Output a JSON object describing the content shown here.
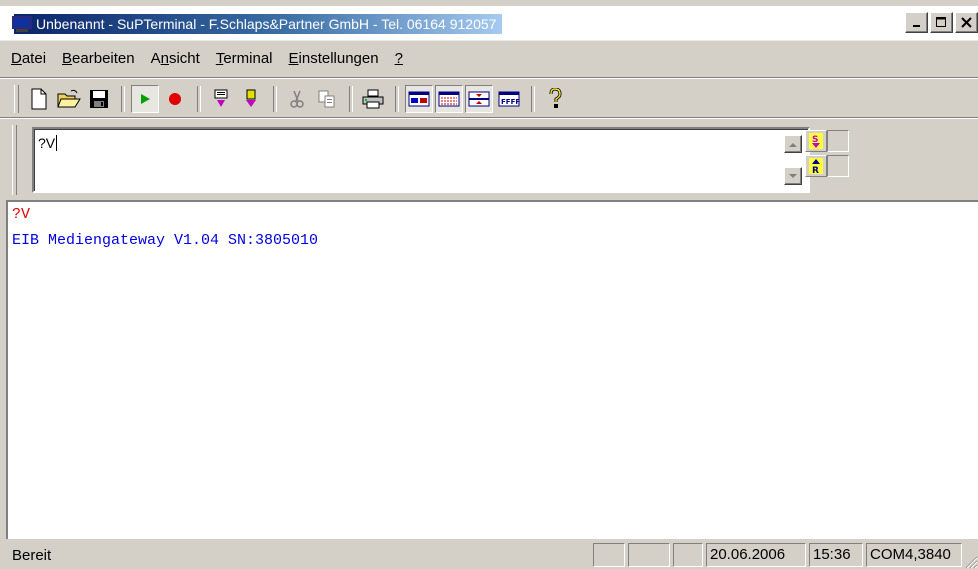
{
  "window": {
    "title": "Unbenannt - SuPTerminal - F.Schlaps&Partner GmbH - Tel. 06164 912057"
  },
  "menu": {
    "items": [
      {
        "label": "Datei",
        "accel": "D",
        "rest": "atei"
      },
      {
        "label": "Bearbeiten",
        "accel": "B",
        "rest": "earbeiten"
      },
      {
        "label": "Ansicht",
        "pre": "A",
        "accel": "n",
        "rest": "sicht"
      },
      {
        "label": "Terminal",
        "accel": "T",
        "rest": "erminal"
      },
      {
        "label": "Einstellungen",
        "accel": "E",
        "rest": "instellungen"
      },
      {
        "label": "?",
        "accel": "?",
        "rest": ""
      }
    ]
  },
  "toolbar": {
    "buttons": [
      "new-document",
      "open-folder",
      "save-disk",
      "run-play",
      "stop-record",
      "send-down",
      "receive-down",
      "cut",
      "copy",
      "print",
      "view-hex",
      "view-table",
      "view-split",
      "view-ffff",
      "help"
    ]
  },
  "input": {
    "value": "?V"
  },
  "side_buttons": {
    "send_icon": "send-s-icon",
    "receive_icon": "receive-r-icon"
  },
  "output": {
    "lines": [
      {
        "text": "?V",
        "color": "#e00000"
      },
      {
        "text": "EIB Mediengateway V1.04 SN:3805010",
        "color": "#0000e0"
      }
    ]
  },
  "status": {
    "text": "Bereit",
    "date": "20.06.2006",
    "time": "15:36",
    "port": "COM4,3840"
  }
}
